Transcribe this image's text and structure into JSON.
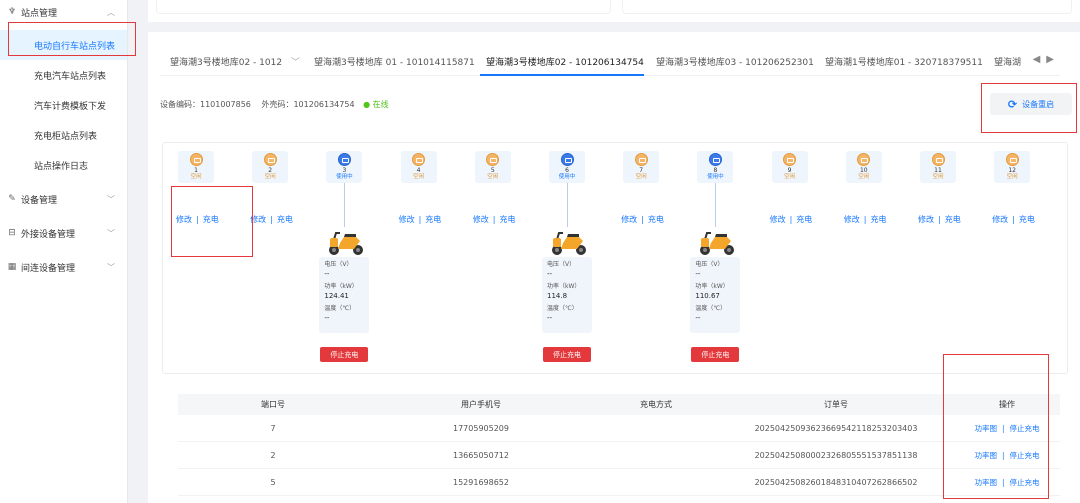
{
  "sidebar": {
    "groups": [
      {
        "label": "站点管理",
        "icon": "trophy-icon",
        "expanded": true,
        "items": [
          {
            "label": "电动自行车站点列表",
            "active": true
          },
          {
            "label": "充电汽车站点列表"
          },
          {
            "label": "汽车计费模板下发"
          },
          {
            "label": "充电柜站点列表"
          },
          {
            "label": "站点操作日志"
          }
        ]
      },
      {
        "label": "设备管理",
        "icon": "edit-icon"
      },
      {
        "label": "外接设备管理",
        "icon": "device-icon"
      },
      {
        "label": "间连设备管理",
        "icon": "grid-icon"
      }
    ]
  },
  "tabs": [
    {
      "label": "望海潮3号楼地库02 - 1012"
    },
    {
      "label": "望海潮3号楼地库 01 - 101014115871"
    },
    {
      "label": "望海潮3号楼地库02 - 101206134754",
      "active": true
    },
    {
      "label": "望海潮3号楼地库03 - 101206252301"
    },
    {
      "label": "望海潮1号楼地库01 - 320718379511"
    },
    {
      "label": "望海湖"
    }
  ],
  "device": {
    "code_label": "设备编码：",
    "code": "1101007856",
    "outer_label": "外壳码：",
    "outer": "101206134754",
    "status": "在线",
    "restart_label": "设备重启"
  },
  "ports": [
    {
      "num": "1",
      "status": "空闲",
      "state": "idle"
    },
    {
      "num": "2",
      "status": "空闲",
      "state": "idle"
    },
    {
      "num": "3",
      "status": "使用中",
      "state": "busy",
      "voltage": "--",
      "power": "124.41",
      "temp": "--"
    },
    {
      "num": "4",
      "status": "空闲",
      "state": "idle"
    },
    {
      "num": "5",
      "status": "空闲",
      "state": "idle"
    },
    {
      "num": "6",
      "status": "使用中",
      "state": "busy",
      "voltage": "--",
      "power": "114.8",
      "temp": "--"
    },
    {
      "num": "7",
      "status": "空闲",
      "state": "idle"
    },
    {
      "num": "8",
      "status": "使用中",
      "state": "busy",
      "voltage": "--",
      "power": "110.67",
      "temp": "--"
    },
    {
      "num": "9",
      "status": "空闲",
      "state": "idle"
    },
    {
      "num": "10",
      "status": "空闲",
      "state": "idle"
    },
    {
      "num": "11",
      "status": "空闲",
      "state": "idle"
    },
    {
      "num": "12",
      "status": "空闲",
      "state": "idle"
    }
  ],
  "port_labels": {
    "edit": "修改",
    "charge": "充电",
    "sep": "|",
    "voltage": "电压（V）",
    "power": "功率（kW）",
    "temp": "温度（℃）",
    "stop": "停止充电"
  },
  "table": {
    "headers": [
      "端口号",
      "用户手机号",
      "充电方式",
      "订单号",
      "操作"
    ],
    "rows": [
      {
        "port": "7",
        "phone": "17705905209",
        "mode": "",
        "order": "20250425093623669542118253203403"
      },
      {
        "port": "2",
        "phone": "13665050712",
        "mode": "",
        "order": "20250425080002326805551537851138"
      },
      {
        "port": "5",
        "phone": "15291698652",
        "mode": "",
        "order": "20250425082601848310407262866502"
      }
    ],
    "op_chart": "功率图",
    "op_sep": "|",
    "op_stop": "停止充电"
  }
}
